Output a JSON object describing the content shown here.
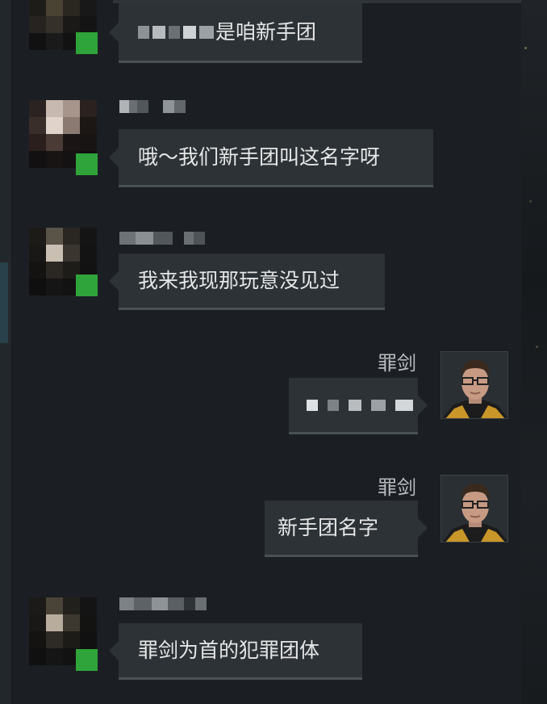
{
  "messages": [
    {
      "side": "left",
      "sender": "",
      "text": "是咱新手团",
      "blurred_prefix": true
    },
    {
      "side": "left",
      "sender": "",
      "text": "哦～我们新手团叫这名字呀"
    },
    {
      "side": "left",
      "sender": "",
      "text": "我来我现那玩意没见过"
    },
    {
      "side": "right",
      "sender": "罪剑",
      "text": "",
      "blurred": true
    },
    {
      "side": "right",
      "sender": "罪剑",
      "text": "新手团名字"
    },
    {
      "side": "left",
      "sender": "",
      "text": "罪剑为首的犯罪团体"
    }
  ],
  "colors": {
    "background": "#1b1f23",
    "bubble": "#2c3236",
    "online": "#2fa43a",
    "text": "#e6e6e6"
  },
  "icons": {
    "avatar": "pixelated-avatar",
    "status": "online-indicator",
    "portrait": "character-portrait"
  }
}
